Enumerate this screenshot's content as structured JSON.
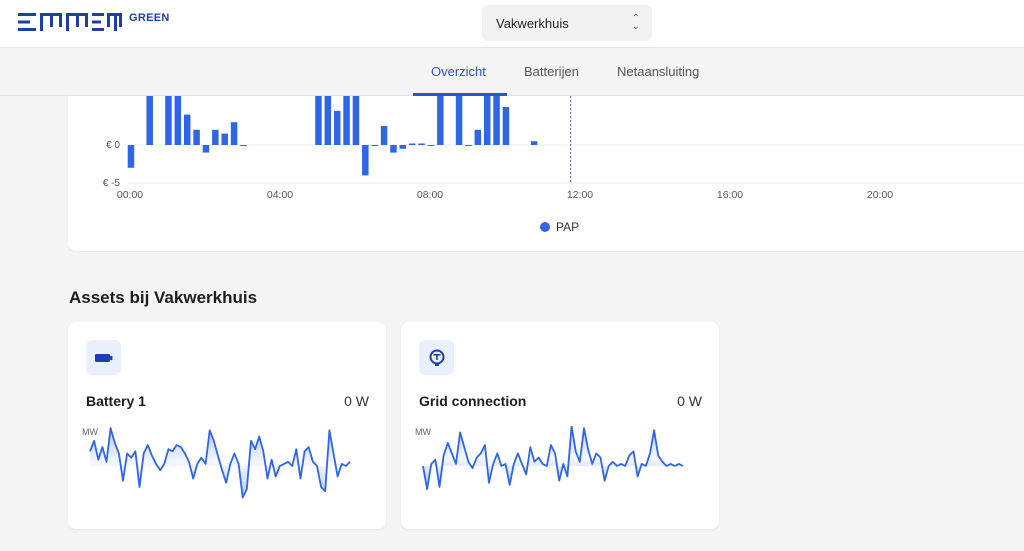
{
  "brand": {
    "logo_suffix": "GREEN",
    "color": "#1e3fa8"
  },
  "header": {
    "location_select": {
      "value": "Vakwerkhuis",
      "icon": "chevron-updown-icon"
    }
  },
  "tabs": [
    {
      "label": "Overzicht",
      "active": true
    },
    {
      "label": "Batterijen",
      "active": false
    },
    {
      "label": "Netaansluiting",
      "active": false
    }
  ],
  "chart_data": {
    "type": "bar",
    "series": [
      {
        "name": "PAP",
        "color": "#2f66e6",
        "x_hours": [
          0,
          0.5,
          1.0,
          1.25,
          1.5,
          1.75,
          2.0,
          2.25,
          2.5,
          2.75,
          3.0,
          5.0,
          5.25,
          5.5,
          5.75,
          6.0,
          6.25,
          6.5,
          6.75,
          7.0,
          7.25,
          7.5,
          7.75,
          8.0,
          8.25,
          8.75,
          9.0,
          9.25,
          9.5,
          9.75,
          10.0,
          10.75
        ],
        "values": [
          -3,
          7,
          12,
          12,
          4,
          2,
          -1,
          2,
          1.5,
          3,
          0,
          12,
          12,
          4.5,
          12,
          12,
          -4,
          0,
          2.5,
          -1,
          -0.5,
          0.2,
          0.2,
          0,
          12,
          12,
          0,
          2,
          12,
          12,
          5,
          0.5
        ]
      }
    ],
    "x_ticks": [
      "00:00",
      "04:00",
      "08:00",
      "12:00",
      "16:00",
      "20:00"
    ],
    "y_ticks": [
      "€ 0",
      "€ -5"
    ],
    "now_marker_hour": 11.75,
    "legend_position": "bottom-center"
  },
  "assets_section": {
    "title": "Assets bij Vakwerkhuis"
  },
  "assets": [
    {
      "name": "Battery 1",
      "value": "0 W",
      "unit": "MW",
      "icon": "battery-icon",
      "sparkline": [
        0.35,
        0.6,
        0.15,
        0.45,
        0.1,
        0.9,
        0.55,
        0.3,
        -0.35,
        0.3,
        0.2,
        0.35,
        -0.5,
        0.3,
        0.5,
        0.25,
        0.05,
        -0.1,
        0.05,
        0.4,
        0.35,
        0.5,
        0.45,
        0.3,
        0.1,
        -0.3,
        0.05,
        0.2,
        0.05,
        0.85,
        0.6,
        0.25,
        -0.1,
        -0.4,
        0.05,
        0.3,
        0.05,
        -0.75,
        -0.55,
        0.6,
        0.4,
        0.7,
        0.35,
        -0.3,
        0.15,
        -0.25,
        0.0,
        0.05,
        0.1,
        0.0,
        0.4,
        -0.3,
        0.35,
        0.45,
        0.1,
        0.0,
        -0.5,
        -0.6,
        0.85,
        0.3,
        -0.25,
        0.05,
        0.0,
        0.1
      ]
    },
    {
      "name": "Grid connection",
      "value": "0 W",
      "unit": "MW",
      "icon": "grid-connection-icon",
      "sparkline": [
        0.0,
        -0.55,
        0.05,
        0.15,
        -0.5,
        0.25,
        0.55,
        0.3,
        0.05,
        0.8,
        0.45,
        0.1,
        -0.05,
        0.2,
        0.3,
        0.5,
        -0.4,
        0.05,
        0.3,
        0.0,
        0.05,
        -0.45,
        0.05,
        0.3,
        0.05,
        -0.2,
        0.45,
        0.1,
        0.2,
        0.05,
        0.0,
        0.5,
        0.3,
        -0.35,
        0.05,
        -0.25,
        0.95,
        0.35,
        0.1,
        0.9,
        0.4,
        0.05,
        0.3,
        0.2,
        -0.35,
        0.0,
        0.1,
        0.0,
        0.05,
        0.0,
        0.25,
        0.35,
        -0.25,
        0.05,
        0.0,
        0.3,
        0.85,
        0.25,
        0.1,
        0.0,
        0.05,
        0.0,
        0.05,
        0.0
      ]
    }
  ]
}
